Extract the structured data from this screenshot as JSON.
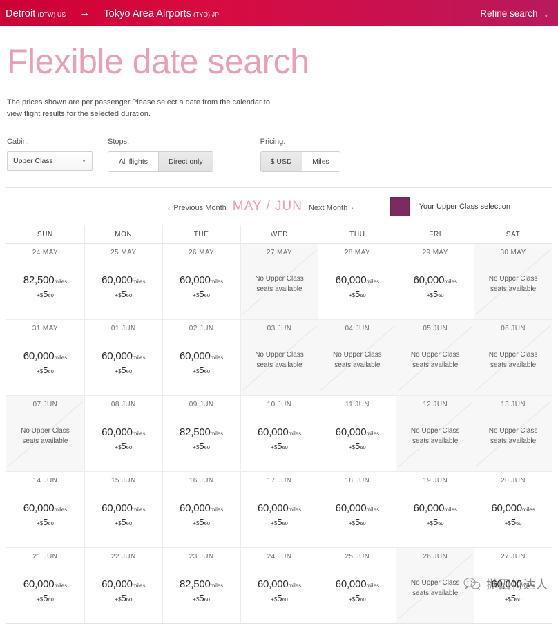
{
  "topbar": {
    "origin_city": "Detroit",
    "origin_code": "(DTW) US",
    "arrow": "→",
    "dest_city": "Tokyo Area Airports",
    "dest_code": "(TYO) JP",
    "refine_label": "Refine search",
    "refine_arrow": "↓",
    "bg_start": "#cc0034",
    "bg_end": "#b81a5c"
  },
  "page": {
    "title": "Flexible date search",
    "title_color": "#e8a0b8",
    "intro": "The prices shown are per passenger.Please select a date from the calendar to view flight results for the selected duration."
  },
  "filters": {
    "cabin": {
      "label": "Cabin:",
      "value": "Upper Class",
      "caret": "▼"
    },
    "stops": {
      "label": "Stops:",
      "options": [
        {
          "label": "All flights",
          "selected": false
        },
        {
          "label": "Direct only",
          "selected": true
        }
      ]
    },
    "pricing": {
      "label": "Pricing:",
      "options": [
        {
          "label": "$ USD",
          "selected": true
        },
        {
          "label": "Miles",
          "selected": false
        }
      ]
    }
  },
  "calendar": {
    "prev_label": "Previous Month",
    "prev_chevron": "‹",
    "months": "MAY / JUN",
    "months_color": "#e79db5",
    "next_label": "Next Month",
    "next_chevron": "›",
    "legend": {
      "swatch_color": "#7c2a60",
      "label": "Your Upper Class selection"
    },
    "day_headers": [
      "SUN",
      "MON",
      "TUE",
      "WED",
      "THU",
      "FRI",
      "SAT"
    ],
    "unavailable_text": "No Upper Class\nseats available",
    "miles_unit": "miles",
    "tax_currency": "$",
    "tax_plus": "+",
    "tax_amount": "5",
    "tax_cents": "60",
    "weeks": [
      [
        {
          "date": "24 MAY",
          "available": true,
          "miles": "82,500"
        },
        {
          "date": "25 MAY",
          "available": true,
          "miles": "60,000"
        },
        {
          "date": "26 MAY",
          "available": true,
          "miles": "60,000"
        },
        {
          "date": "27 MAY",
          "available": false,
          "miles": ""
        },
        {
          "date": "28 MAY",
          "available": true,
          "miles": "60,000"
        },
        {
          "date": "29 MAY",
          "available": true,
          "miles": "60,000"
        },
        {
          "date": "30 MAY",
          "available": false,
          "miles": ""
        }
      ],
      [
        {
          "date": "31 MAY",
          "available": true,
          "miles": "60,000"
        },
        {
          "date": "01 JUN",
          "available": true,
          "miles": "60,000"
        },
        {
          "date": "02 JUN",
          "available": true,
          "miles": "60,000"
        },
        {
          "date": "03 JUN",
          "available": false,
          "miles": ""
        },
        {
          "date": "04 JUN",
          "available": false,
          "miles": ""
        },
        {
          "date": "05 JUN",
          "available": false,
          "miles": ""
        },
        {
          "date": "06 JUN",
          "available": false,
          "miles": ""
        }
      ],
      [
        {
          "date": "07 JUN",
          "available": false,
          "miles": ""
        },
        {
          "date": "08 JUN",
          "available": true,
          "miles": "60,000"
        },
        {
          "date": "09 JUN",
          "available": true,
          "miles": "82,500"
        },
        {
          "date": "10 JUN",
          "available": true,
          "miles": "60,000"
        },
        {
          "date": "11 JUN",
          "available": true,
          "miles": "60,000"
        },
        {
          "date": "12 JUN",
          "available": false,
          "miles": ""
        },
        {
          "date": "13 JUN",
          "available": false,
          "miles": ""
        }
      ],
      [
        {
          "date": "14 JUN",
          "available": true,
          "miles": "60,000"
        },
        {
          "date": "15 JUN",
          "available": true,
          "miles": "60,000"
        },
        {
          "date": "16 JUN",
          "available": true,
          "miles": "60,000"
        },
        {
          "date": "17 JUN",
          "available": true,
          "miles": "60,000"
        },
        {
          "date": "18 JUN",
          "available": true,
          "miles": "60,000"
        },
        {
          "date": "19 JUN",
          "available": true,
          "miles": "60,000"
        },
        {
          "date": "20 JUN",
          "available": true,
          "miles": "60,000"
        }
      ],
      [
        {
          "date": "21 JUN",
          "available": true,
          "miles": "60,000"
        },
        {
          "date": "22 JUN",
          "available": true,
          "miles": "60,000"
        },
        {
          "date": "23 JUN",
          "available": true,
          "miles": "82,500"
        },
        {
          "date": "24 JUN",
          "available": true,
          "miles": "60,000"
        },
        {
          "date": "25 JUN",
          "available": true,
          "miles": "60,000"
        },
        {
          "date": "26 JUN",
          "available": false,
          "miles": ""
        },
        {
          "date": "27 JUN",
          "available": true,
          "miles": "60,000"
        }
      ]
    ]
  },
  "watermark": {
    "text": "抛因特达人"
  }
}
